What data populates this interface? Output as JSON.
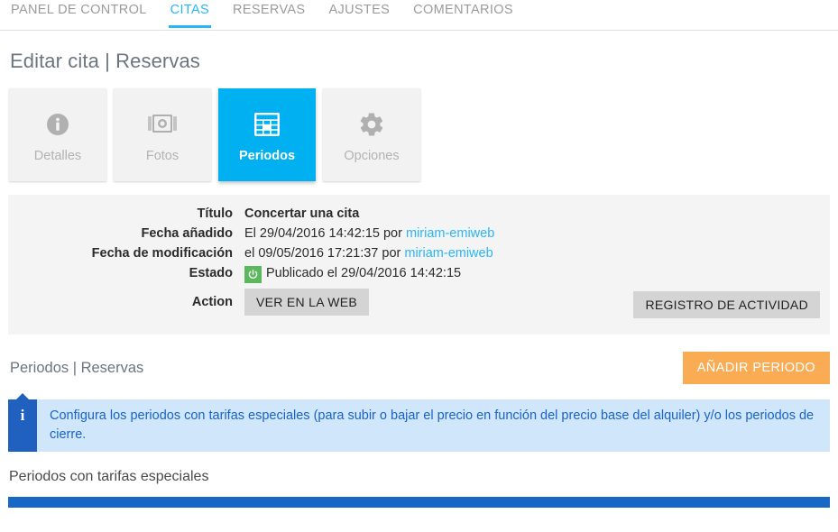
{
  "topnav": {
    "items": [
      {
        "label": "PANEL DE CONTROL",
        "active": false
      },
      {
        "label": "CITAS",
        "active": true
      },
      {
        "label": "RESERVAS",
        "active": false
      },
      {
        "label": "AJUSTES",
        "active": false
      },
      {
        "label": "COMENTARIOS",
        "active": false
      }
    ]
  },
  "page": {
    "title": "Editar cita | Reservas"
  },
  "tabcards": [
    {
      "label": "Detalles",
      "icon": "info-circle-icon",
      "active": false
    },
    {
      "label": "Fotos",
      "icon": "camera-icon",
      "active": false
    },
    {
      "label": "Periodos",
      "icon": "table-grid-icon",
      "active": true
    },
    {
      "label": "Opciones",
      "icon": "gear-icon",
      "active": false
    }
  ],
  "info_panel": {
    "rows": [
      {
        "label": "Título",
        "value": "Concertar una cita",
        "bold": true
      },
      {
        "label": "Fecha añadido",
        "value": "El 29/04/2016 14:42:15 por ",
        "link": "miriam-emiweb"
      },
      {
        "label": "Fecha de modificación",
        "value": "el 09/05/2016 17:21:37 por ",
        "link": "miriam-emiweb"
      },
      {
        "label": "Estado",
        "value": "Publicado el 29/04/2016 14:42:15",
        "badge": "power-icon",
        "badge_color": "#5cb85c"
      },
      {
        "label": "Action",
        "button": "VER EN LA WEB"
      }
    ],
    "activity_button": "REGISTRO DE ACTIVIDAD"
  },
  "section": {
    "title": "Periodos | Reservas",
    "add_button": "AÑADIR PERIODO"
  },
  "alert": {
    "icon": "info-icon",
    "text": "Configura los periodos con tarifas especiales (para subir o bajar el precio en función del precio base del alquiler) y/o los periodos de cierre."
  },
  "bottom": {
    "title": "Periodos con tarifas especiales"
  },
  "colors": {
    "accent_blue": "#29b6f6",
    "active_tab_blue": "#00b0f0",
    "orange": "#f9ac54",
    "alert_bar": "#2061c0",
    "alert_bg": "#cfe6fb",
    "green": "#5cb85c",
    "bottom_bar": "#1668c4"
  }
}
